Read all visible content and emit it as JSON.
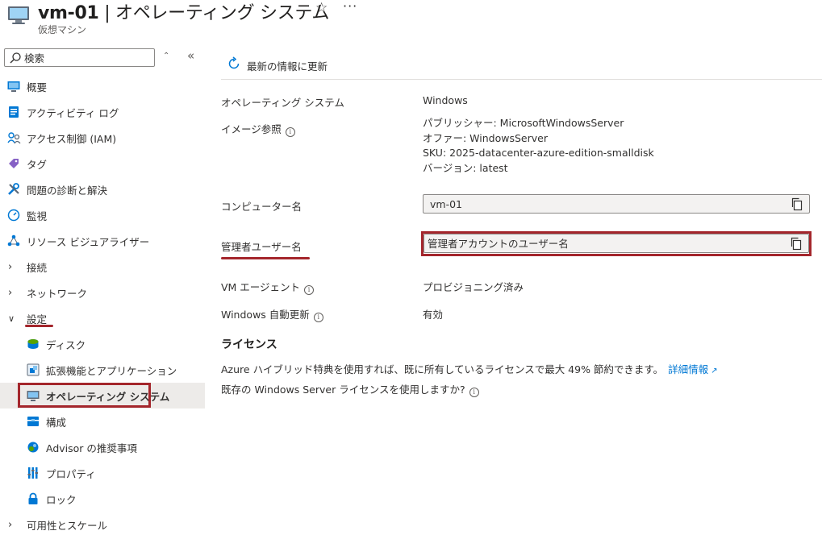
{
  "header": {
    "vm_name": "vm-01",
    "separator": " | ",
    "page_name": "オペレーティング システム",
    "subtitle": "仮想マシン"
  },
  "sidebar": {
    "search_placeholder": "検索",
    "items": [
      {
        "label": "概要",
        "icon": "monitor-icon"
      },
      {
        "label": "アクティビティ ログ",
        "icon": "activity-log-icon"
      },
      {
        "label": "アクセス制御 (IAM)",
        "icon": "iam-people-icon"
      },
      {
        "label": "タグ",
        "icon": "tag-icon"
      },
      {
        "label": "問題の診断と解決",
        "icon": "wrench-icon"
      },
      {
        "label": "監視",
        "icon": "monitor-gauge-icon"
      },
      {
        "label": "リソース ビジュアライザー",
        "icon": "resource-visualizer-icon"
      },
      {
        "label": "接続",
        "icon": "chevron-right-icon"
      },
      {
        "label": "ネットワーク",
        "icon": "chevron-right-icon"
      },
      {
        "label": "設定",
        "icon": "chevron-down-icon"
      },
      {
        "label": "ディスク",
        "icon": "disk-icon"
      },
      {
        "label": "拡張機能とアプリケーション",
        "icon": "extensions-icon"
      },
      {
        "label": "オペレーティング システム",
        "icon": "os-monitor-icon"
      },
      {
        "label": "構成",
        "icon": "configuration-icon"
      },
      {
        "label": "Advisor の推奨事項",
        "icon": "advisor-icon"
      },
      {
        "label": "プロパティ",
        "icon": "properties-icon"
      },
      {
        "label": "ロック",
        "icon": "lock-icon"
      },
      {
        "label": "可用性とスケール",
        "icon": "chevron-right-icon"
      }
    ]
  },
  "toolbar": {
    "refresh_label": "最新の情報に更新"
  },
  "details": {
    "os_label": "オペレーティング システム",
    "os_value": "Windows",
    "image_ref_label": "イメージ参照",
    "publisher": "パブリッシャー: MicrosoftWindowsServer",
    "offer": "オファー: WindowsServer",
    "sku": "SKU: 2025-datacenter-azure-edition-smalldisk",
    "version": "バージョン: latest",
    "computer_name_label": "コンピューター名",
    "computer_name_value": "vm-01",
    "admin_user_label": "管理者ユーザー名",
    "admin_user_placeholder": "管理者アカウントのユーザー名",
    "vm_agent_label": "VM エージェント",
    "vm_agent_value": "プロビジョニング済み",
    "auto_update_label": "Windows 自動更新",
    "auto_update_value": "有効"
  },
  "license": {
    "title": "ライセンス",
    "text": "Azure ハイブリッド特典を使用すれば、既に所有しているライセンスで最大 49% 節約できます。",
    "learn_more": "詳細情報",
    "question": "既存の Windows Server ライセンスを使用しますか?"
  },
  "colors": {
    "highlight_red": "#a4262c",
    "link_blue": "#0078d4",
    "selected_bg": "#edebe9"
  }
}
